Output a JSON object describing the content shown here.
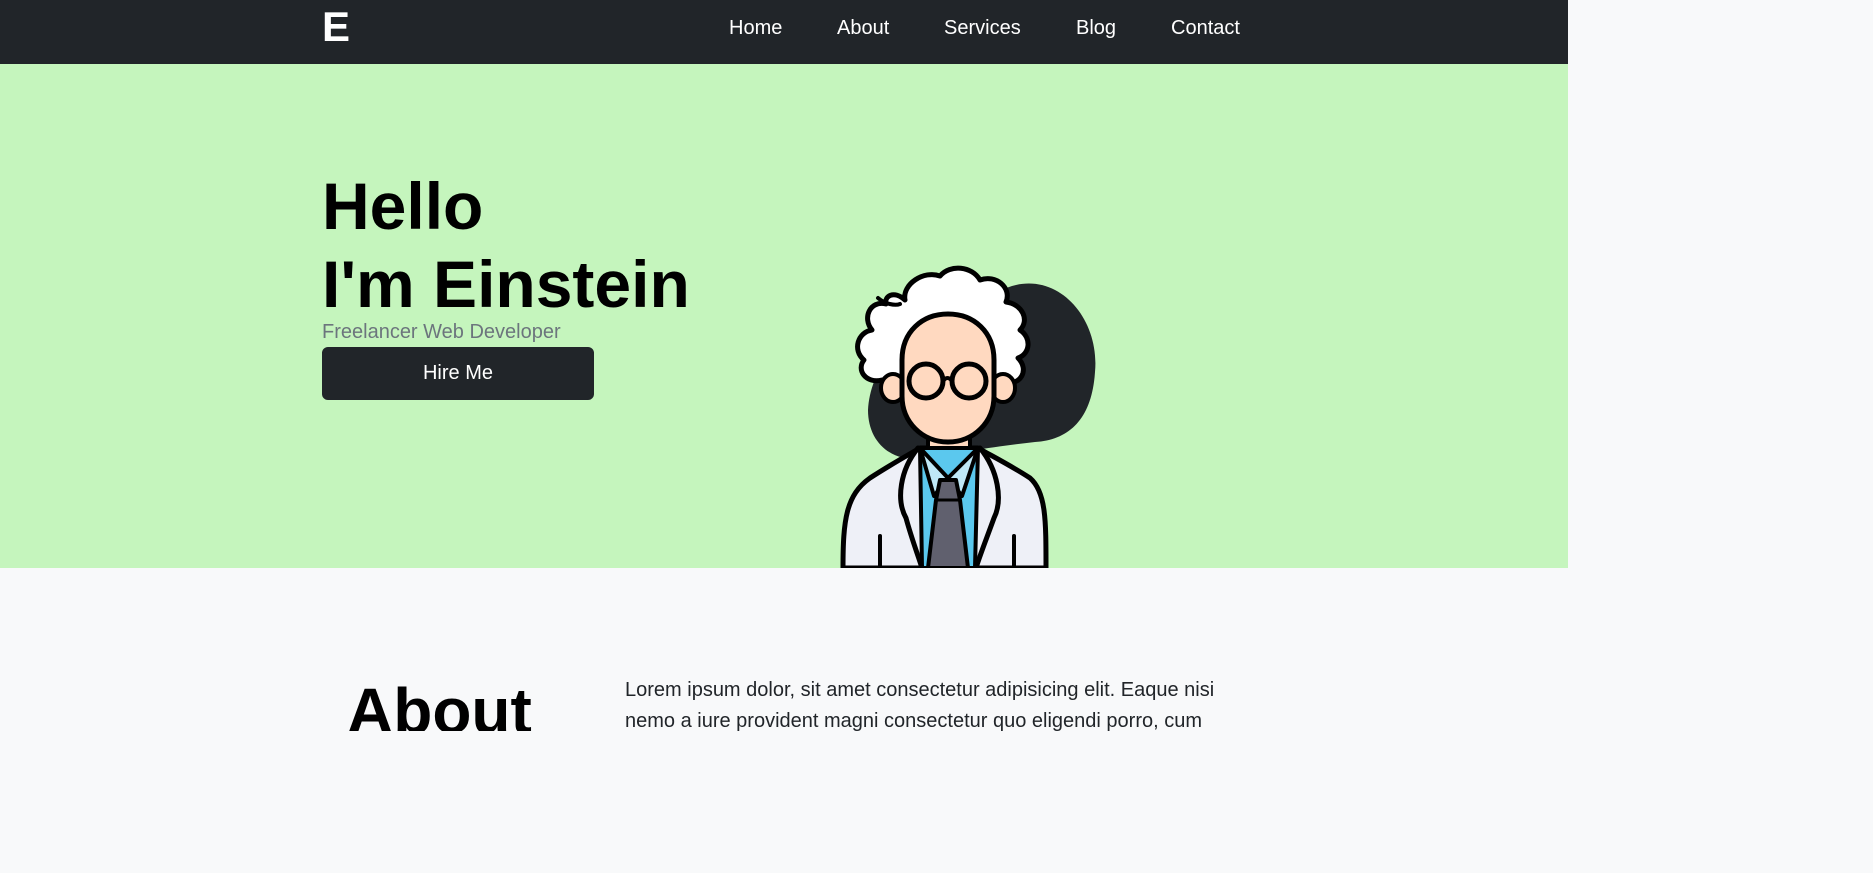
{
  "navbar": {
    "brand": "E",
    "links": [
      "Home",
      "About",
      "Services",
      "Blog",
      "Contact"
    ]
  },
  "hero": {
    "title_line1": "Hello",
    "title_line2": "I'm Einstein",
    "subtitle": "Freelancer Web Developer",
    "cta_label": "Hire Me",
    "illustration": "einstein-avatar-illustration"
  },
  "about": {
    "heading": "About",
    "text": "Lorem ipsum dolor, sit amet consectetur adipisicing elit. Eaque nisi nemo a iure provident magni consectetur quo eligendi porro, cum"
  },
  "colors": {
    "navbar_bg": "#212529",
    "hero_bg": "#c5f5bd",
    "about_bg": "#f8f9fa",
    "subtitle": "#6c757d",
    "button_bg": "#212529"
  }
}
